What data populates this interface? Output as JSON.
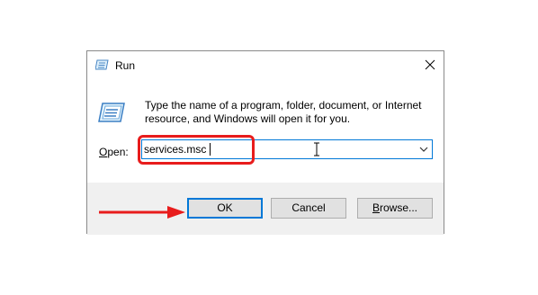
{
  "window": {
    "title": "Run",
    "description": "Type the name of a program, folder, document, or Internet resource, and Windows will open it for you.",
    "open_label_prefix": "",
    "open_label_underlined": "O",
    "open_label_rest": "pen:",
    "input_value": "services.msc"
  },
  "buttons": {
    "ok": "OK",
    "cancel": "Cancel",
    "browse_underlined": "B",
    "browse_rest": "rowse..."
  },
  "icons": {
    "title": "run-icon",
    "main": "run-icon",
    "close": "close-icon",
    "dropdown": "chevron-down-icon",
    "cursor": "text-cursor-icon",
    "annotation": "arrow-right-icon"
  },
  "colors": {
    "highlight": "#e81c1c",
    "focus": "#0078d7",
    "button_bar": "#f0f0f0"
  }
}
